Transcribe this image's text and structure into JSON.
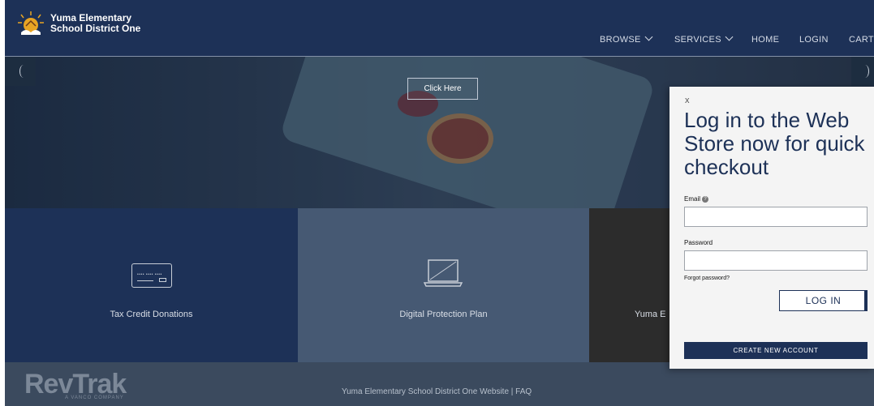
{
  "header": {
    "brand_line1": "Yuma Elementary",
    "brand_line2": "School District One",
    "nav": {
      "browse": "BROWSE",
      "services": "SERVICES",
      "home": "HOME",
      "login": "LOGIN",
      "cart": "CART"
    }
  },
  "hero": {
    "cta_label": "Click Here"
  },
  "tiles": [
    {
      "label": "Tax Credit Donations",
      "icon": "credit-card-icon"
    },
    {
      "label": "Digital Protection Plan",
      "icon": "laptop-icon"
    },
    {
      "label": "Yuma E"
    }
  ],
  "footer": {
    "logo_text": "RevTrak",
    "logo_subtext": "A VANCO COMPANY",
    "links_text": "Yuma Elementary School District One Website | FAQ"
  },
  "login_panel": {
    "close_label": "x",
    "title": "Log in to the Web Store now for quick checkout",
    "email_label": "Email",
    "email_value": "",
    "password_label": "Password",
    "password_value": "",
    "forgot_label": "Forgot password?",
    "login_button": "LOG IN",
    "create_button": "CREATE NEW ACCOUNT"
  },
  "colors": {
    "navy": "#1d3157",
    "slate": "#465973",
    "charcoal": "#2c2c2c",
    "footer": "#3b4a5e",
    "panel": "#f4f4f4"
  }
}
